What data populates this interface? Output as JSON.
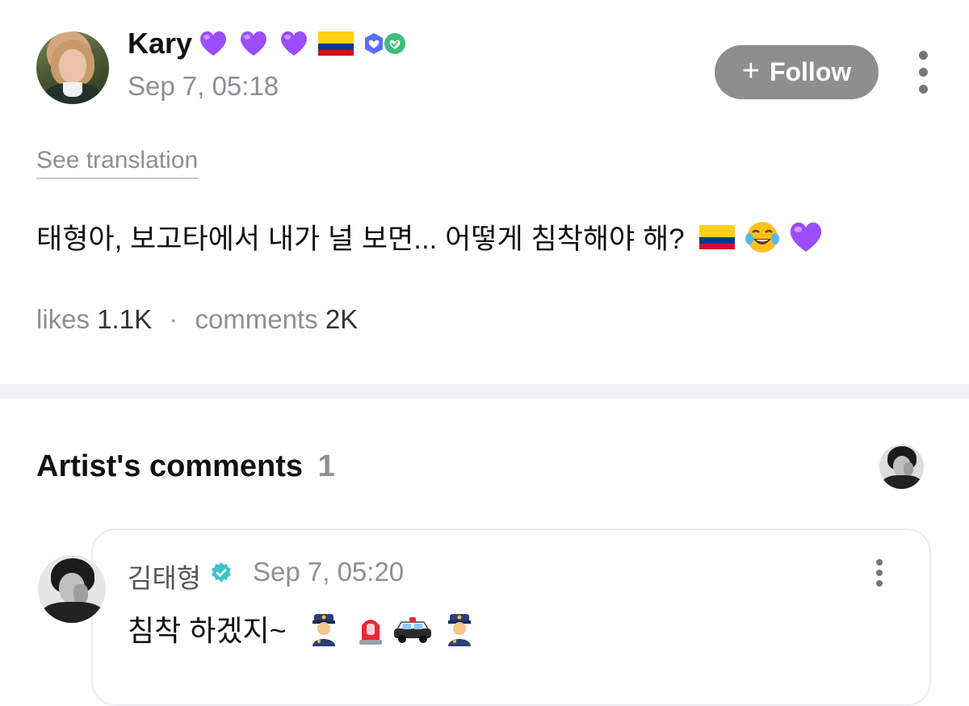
{
  "post": {
    "author_name": "Kary",
    "name_emojis": [
      "purple-heart",
      "purple-heart",
      "purple-heart",
      "colombia-flag"
    ],
    "badges": [
      "shield-heart-badge",
      "check-heart-badge"
    ],
    "timestamp": "Sep 7, 05:18",
    "follow_label": "Follow",
    "see_translation": "See translation",
    "text": "태형아, 보고타에서 내가 널 보면... 어떻게 침착해야 해?",
    "text_emojis": [
      "colombia-flag",
      "tears-of-joy",
      "purple-heart"
    ],
    "likes_label": "likes",
    "likes_count": "1.1K",
    "comments_label": "comments",
    "comments_count": "2K"
  },
  "artist_comments": {
    "title": "Artist's comments",
    "count": "1",
    "comment": {
      "author_name": "김태형",
      "timestamp": "Sep 7, 05:20",
      "text": "침착 하겠지~",
      "emojis": [
        "police-officer",
        "rotating-light",
        "police-car",
        "police-officer"
      ]
    }
  },
  "colors": {
    "accent_purple": "#9b4dff",
    "follow_button_bg": "#8e8e8e",
    "verified_teal": "#3cc3c8",
    "muted_text": "#8e8e93"
  }
}
